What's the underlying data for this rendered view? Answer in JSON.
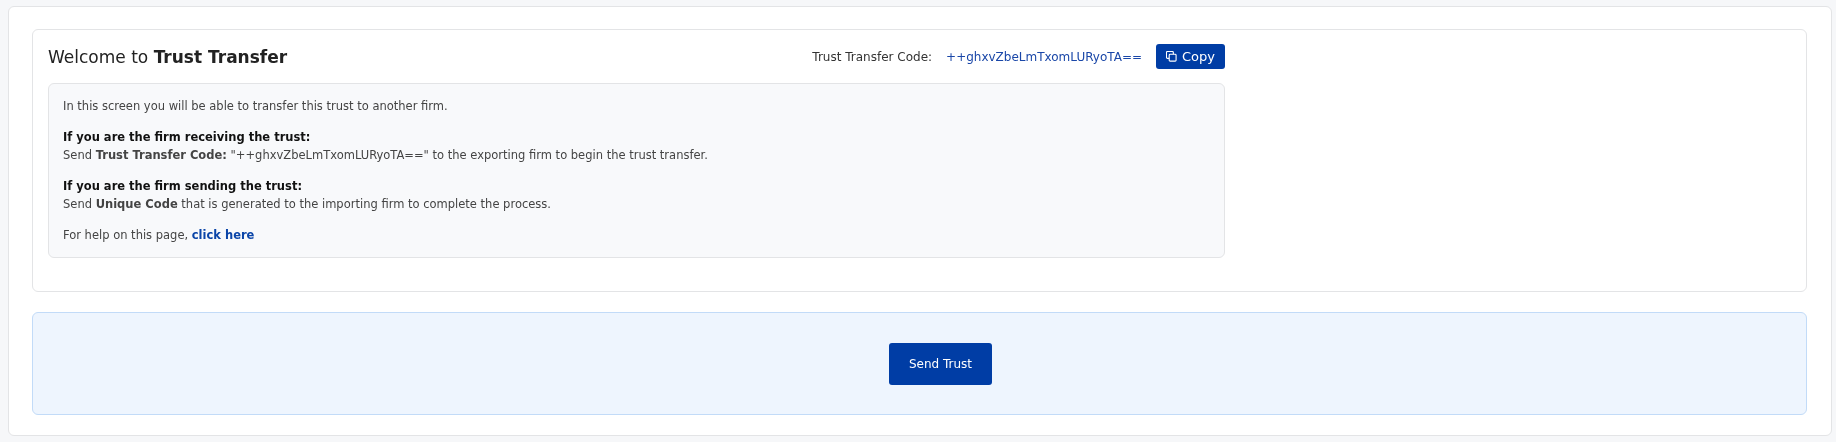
{
  "heading": {
    "prefix": "Welcome to",
    "title": "Trust Transfer"
  },
  "code_bar": {
    "label": "Trust Transfer Code:",
    "code": "++ghxvZbeLmTxomLURyoTA==",
    "copy_button": "Copy"
  },
  "info": {
    "intro": "In this screen you will be able to transfer this trust to another firm.",
    "sections": [
      {
        "heading": "If you are the firm receiving the trust:",
        "text": "Send **Trust Transfer Code:** \"++ghxvZbeLmTxomLURyoTA==\" to the exporting firm to begin the trust transfer."
      },
      {
        "heading": "If you are the firm sending the trust:",
        "text": "Send **Unique Code** that is generated to the importing firm to complete the process."
      }
    ],
    "help_text": "For help on this page,",
    "help_link": "click here"
  },
  "action_button": "Send Trust"
}
